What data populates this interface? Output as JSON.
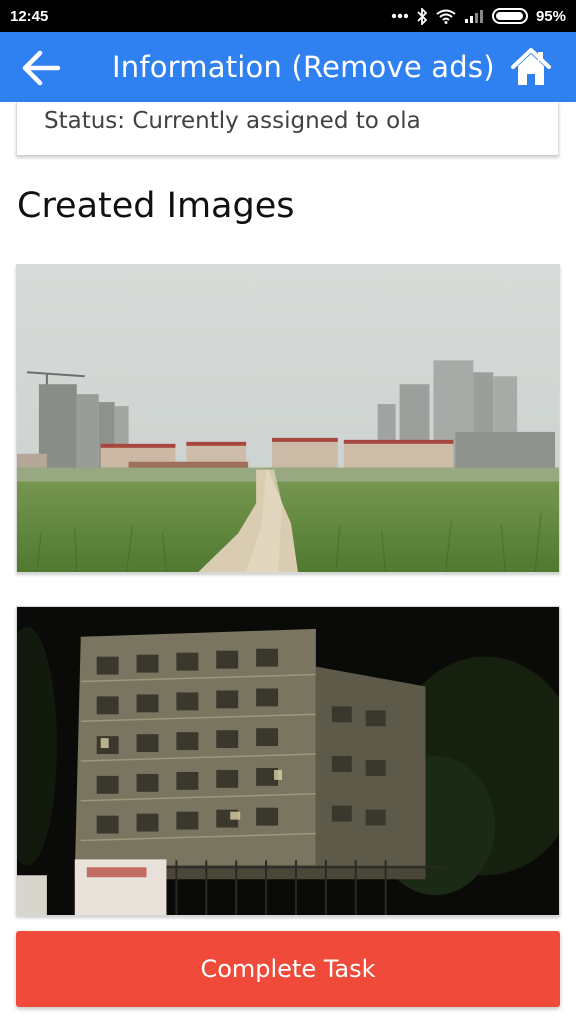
{
  "status_bar": {
    "time": "12:45",
    "battery_percent": "95%",
    "battery_level": 0.95,
    "icons": [
      "dots-icon",
      "bluetooth-icon",
      "wifi-icon",
      "signal-icon",
      "battery-icon"
    ]
  },
  "app_bar": {
    "title": "Information (Remove ads)",
    "back_icon": "arrow-left-icon",
    "home_icon": "home-icon",
    "color": "#2f80f1"
  },
  "task": {
    "status": "Status: Currently assigned to ola"
  },
  "images_section": {
    "heading": "Created Images",
    "images": [
      {
        "scene": "grass-field-with-dirt-path-and-distant-highrises"
      },
      {
        "scene": "old-apartment-building-at-night"
      }
    ]
  },
  "actions": {
    "complete_label": "Complete Task",
    "complete_color": "#f04a3a"
  }
}
